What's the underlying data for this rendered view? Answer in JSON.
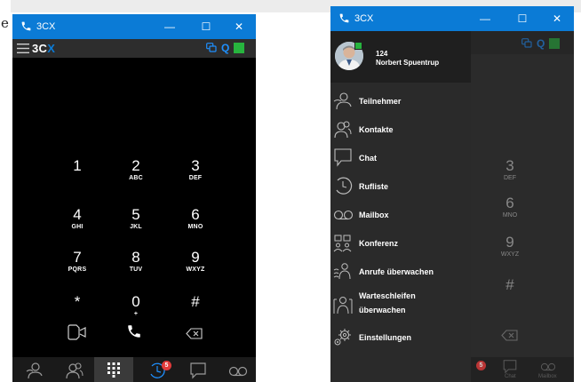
{
  "edge_fragment": "e",
  "windows": [
    {
      "app_name": "3CX",
      "controls": {
        "minimize": "—",
        "maximize": "☐",
        "close": "✕"
      },
      "logo": {
        "main": "3C",
        "accent": "X"
      },
      "keypad": [
        {
          "digit": "1",
          "letters": ""
        },
        {
          "digit": "2",
          "letters": "ABC"
        },
        {
          "digit": "3",
          "letters": "DEF"
        },
        {
          "digit": "4",
          "letters": "GHI"
        },
        {
          "digit": "5",
          "letters": "JKL"
        },
        {
          "digit": "6",
          "letters": "MNO"
        },
        {
          "digit": "7",
          "letters": "PQRS"
        },
        {
          "digit": "8",
          "letters": "TUV"
        },
        {
          "digit": "9",
          "letters": "WXYZ"
        },
        {
          "digit": "*",
          "letters": ""
        },
        {
          "digit": "0",
          "letters": "+"
        },
        {
          "digit": "#",
          "letters": ""
        }
      ],
      "nav_badge": "5",
      "active_nav": "dialpad"
    },
    {
      "app_name": "3CX",
      "controls": {
        "minimize": "—",
        "maximize": "☐",
        "close": "✕"
      },
      "profile": {
        "extension": "124",
        "name": "Norbert Spuentrup"
      },
      "menu": [
        {
          "id": "teilnehmer",
          "label": "Teilnehmer"
        },
        {
          "id": "kontakte",
          "label": "Kontakte"
        },
        {
          "id": "chat",
          "label": "Chat"
        },
        {
          "id": "rufliste",
          "label": "Rufliste"
        },
        {
          "id": "mailbox",
          "label": "Mailbox"
        },
        {
          "id": "konferenz",
          "label": "Konferenz"
        },
        {
          "id": "anrufe",
          "label": "Anrufe überwachen"
        },
        {
          "id": "warteschleifen",
          "label": "Warteschleifen überwachen"
        },
        {
          "id": "einstellungen",
          "label": "Einstellungen"
        }
      ],
      "bg_keypad": [
        {
          "digit": "3",
          "letters": "DEF"
        },
        {
          "digit": "6",
          "letters": "MNO"
        },
        {
          "digit": "9",
          "letters": "WXYZ"
        },
        {
          "digit": "#",
          "letters": ""
        }
      ],
      "nav_badge": "5",
      "nav_labels": {
        "chat": "Chat",
        "mailbox": "Mailbox"
      }
    }
  ],
  "colors": {
    "titlebar": "#0b7bd6",
    "presence": "#27b43e",
    "badge": "#e03a3a",
    "accent_blue": "#1e90ff"
  }
}
